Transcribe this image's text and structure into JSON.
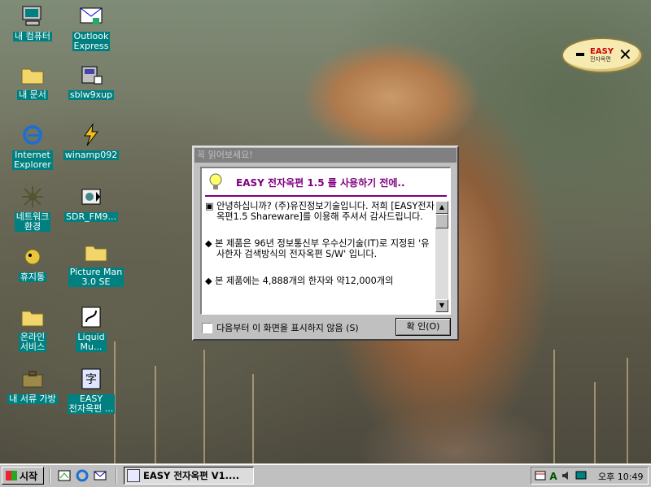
{
  "desktop": {
    "icons": [
      {
        "label": "내 컴퓨터"
      },
      {
        "label": "Outlook\nExpress"
      },
      {
        "label": "내 문서"
      },
      {
        "label": "sblw9xup"
      },
      {
        "label": "Internet\nExplorer"
      },
      {
        "label": "winamp092"
      },
      {
        "label": "네트워크\n환경"
      },
      {
        "label": "SDR_FM9..."
      },
      {
        "label": "휴지통"
      },
      {
        "label": "Picture Man\n3.0 SE"
      },
      {
        "label": "온라인\n서비스"
      },
      {
        "label": "Liquid\nMu..."
      },
      {
        "label": "내 서류 가방"
      },
      {
        "label": "EASY\n전자옥편 ..."
      }
    ]
  },
  "easy_widget": {
    "logo": "EASY",
    "sub": "전자옥편",
    "close": "✕"
  },
  "dialog": {
    "title": "꼭 읽어보세요!",
    "heading": "EASY 전자옥편 1.5 를 사용하기 전에..",
    "paragraphs": [
      "▣ 안녕하십니까? (주)유진정보기술입니다. 저희 [EASY전자옥편1.5 Shareware]를 이용해 주셔서 감사드립니다.",
      "◆ 본 제품은 96년 정보통신부 우수신기술(IT)로 지정된 '유사한자 검색방식의 전자옥편 S/W' 입니다.",
      "◆ 본 제품에는 4,888개의 한자와 약12,000개의"
    ],
    "checkbox_label": "다음부터 이 화면을 표시하지 않음 (S)",
    "ok_label": "확 인(O)"
  },
  "taskbar": {
    "start_label": "시작",
    "task_label": "EASY 전자옥편 V1....",
    "clock": "오후 10:49"
  }
}
